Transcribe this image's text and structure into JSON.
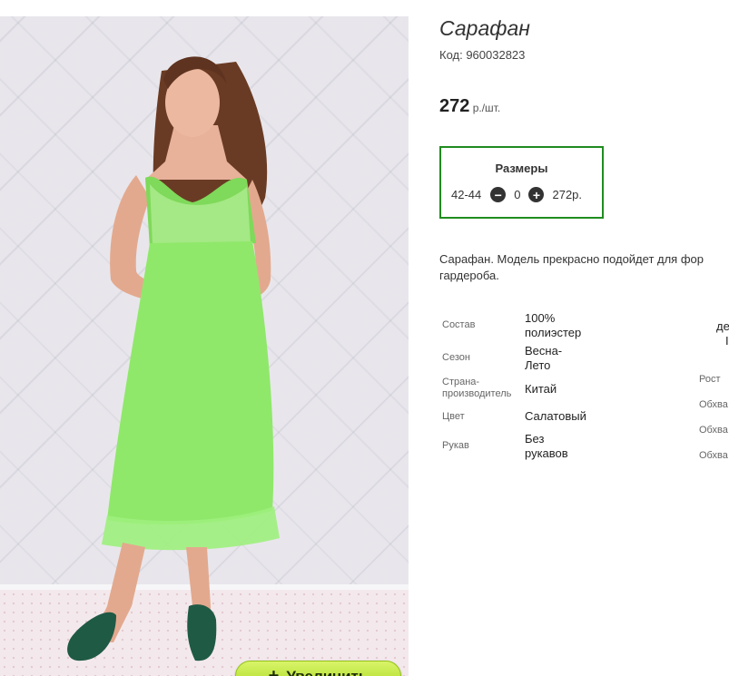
{
  "product": {
    "title": "Сарафан",
    "code": "Код: 960032823",
    "price_value": "272",
    "price_unit": " р./шт.",
    "zoom_label": "Увеличить",
    "zoom_plus": "+"
  },
  "sizes": {
    "header": "Размеры",
    "size": "42-44",
    "quantity": "0",
    "sum": "272р.",
    "minus": "−",
    "plus": "+"
  },
  "description": {
    "line1": "Сарафан. Модель прекрасно подойдет для фор",
    "line2": "гардероба."
  },
  "specs": [
    {
      "key": "Состав",
      "value_lines": [
        "100%",
        "полиэстер"
      ]
    },
    {
      "key": "Сезон",
      "value_lines": [
        "Весна-",
        "Лето"
      ]
    },
    {
      "key_lines": [
        "Страна-",
        "производитель"
      ],
      "value_lines": [
        "Китай"
      ]
    },
    {
      "key": "Цвет",
      "value_lines": [
        "Салатовый"
      ]
    },
    {
      "key": "Рукав",
      "value_lines": [
        "Без",
        "рукавов"
      ]
    }
  ],
  "right_specs": {
    "top_lines": [
      "де",
      "I"
    ],
    "items": [
      "Рост",
      "Обхва",
      "Обхва",
      "Обхва"
    ]
  },
  "colors": {
    "border_green": "#1f8c1f",
    "button_lime": "#b7e234",
    "dress_green": "#8fe86a"
  }
}
